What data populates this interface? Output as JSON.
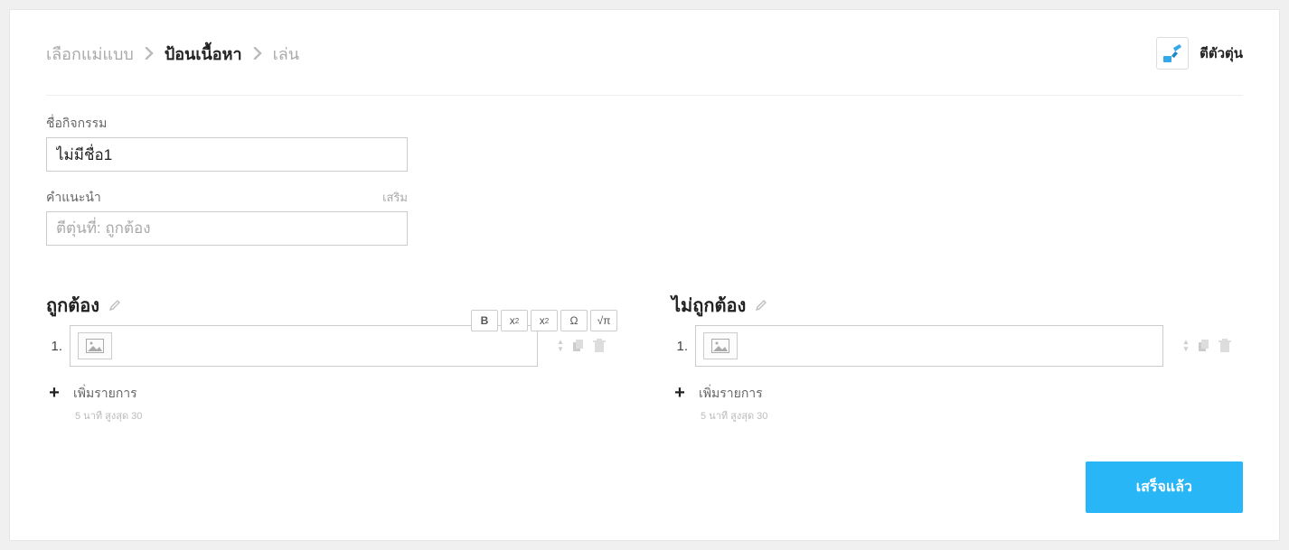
{
  "breadcrumbs": {
    "step1": "เลือกแม่แบบ",
    "step2": "ป้อนเนื้อหา",
    "step3": "เล่น"
  },
  "game": {
    "name": "ตีตัวตุ่น"
  },
  "activityName": {
    "label": "ชื่อกิจกรรม",
    "value": "ไม่มีชื่อ1"
  },
  "instructions": {
    "label": "คำแนะนำ",
    "optional": "เสริม",
    "placeholder": "ตีตุ่นที่: ถูกต้อง"
  },
  "columns": {
    "correct": {
      "title": "ถูกต้อง",
      "items": [
        {
          "num": "1."
        }
      ],
      "add": "เพิ่มรายการ",
      "hint": "5 นาที  สูงสุด 30"
    },
    "incorrect": {
      "title": "ไม่ถูกต้อง",
      "items": [
        {
          "num": "1."
        }
      ],
      "add": "เพิ่มรายการ",
      "hint": "5 นาที  สูงสุด 30"
    }
  },
  "toolbar": {
    "bold": "B",
    "sup": "x",
    "supExp": "2",
    "sub": "x",
    "subExp": "2",
    "omega": "Ω",
    "sqrt": "√π"
  },
  "footer": {
    "done": "เสร็จแล้ว"
  }
}
